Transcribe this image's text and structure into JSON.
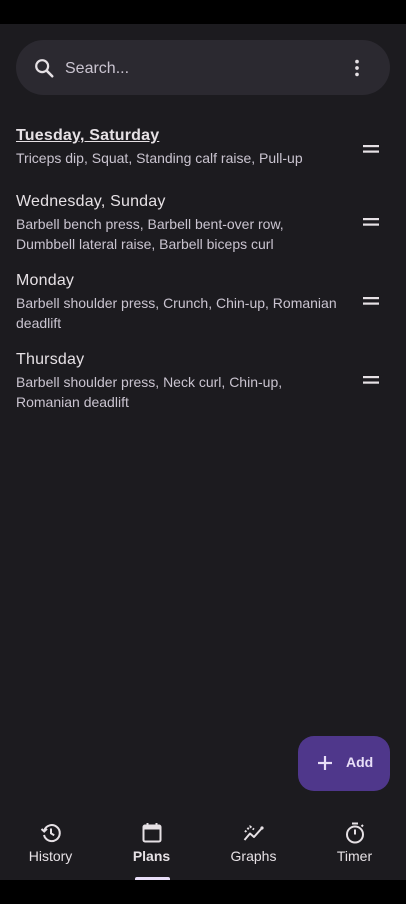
{
  "search": {
    "placeholder": "Search..."
  },
  "plans": [
    {
      "title": "Tuesday, Saturday",
      "exercises": "Triceps dip,  Squat, Standing calf raise, Pull-up",
      "selected": true
    },
    {
      "title": "Wednesday, Sunday",
      "exercises": "Barbell bench press, Barbell bent-over row, Dumbbell lateral raise, Barbell biceps curl"
    },
    {
      "title": "Monday",
      "exercises": "Barbell shoulder press, Crunch, Chin-up, Romanian deadlift"
    },
    {
      "title": "Thursday",
      "exercises": "Barbell shoulder press, Neck curl, Chin-up, Romanian deadlift"
    }
  ],
  "fab": {
    "label": "Add",
    "icon": "plus-icon"
  },
  "nav": [
    {
      "label": "History",
      "icon": "history-icon"
    },
    {
      "label": "Plans",
      "icon": "calendar-icon",
      "active": true
    },
    {
      "label": "Graphs",
      "icon": "graphs-icon"
    },
    {
      "label": "Timer",
      "icon": "timer-icon"
    }
  ],
  "colors": {
    "background": "#1C1B1F",
    "surface": "#2B2930",
    "primary_container": "#4F378B",
    "on_surface": "#E6E1E5",
    "on_surface_variant": "#CAC4D0"
  }
}
